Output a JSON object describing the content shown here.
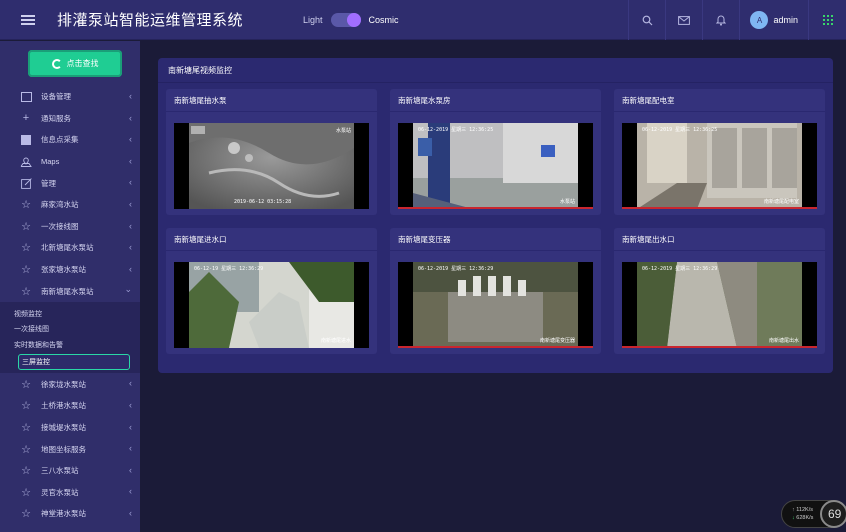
{
  "header": {
    "title": "排灌泵站智能运维管理系统",
    "theme_light": "Light",
    "theme_dark": "Cosmic",
    "user_avatar": "A",
    "username": "admin"
  },
  "sidebar": {
    "search_button": "点击查找",
    "items": [
      {
        "label": "设备管理"
      },
      {
        "label": "通知服务"
      },
      {
        "label": "信息点采集"
      },
      {
        "label": "Maps"
      },
      {
        "label": "管理"
      },
      {
        "label": "麻家湾水站"
      },
      {
        "label": "一次接线图"
      },
      {
        "label": "北新塘尾水泵站"
      },
      {
        "label": "张家塘水泵站"
      },
      {
        "label": "南新塘尾水泵站"
      },
      {
        "label": "徐家垅水泵站"
      },
      {
        "label": "土桥港水泵站"
      },
      {
        "label": "接城堤水泵站"
      },
      {
        "label": "地图坐标服务"
      },
      {
        "label": "三八水泵站"
      },
      {
        "label": "灵官水泵站"
      },
      {
        "label": "神堂港水泵站"
      }
    ],
    "submenu": [
      {
        "label": "视频监控"
      },
      {
        "label": "一次接线图"
      },
      {
        "label": "实时数据和告警"
      },
      {
        "label": "三屏监控"
      }
    ]
  },
  "main": {
    "title": "南新塘尾视频监控",
    "videos": [
      {
        "title": "南新塘尾抽水泵",
        "timestamp": "",
        "camera": "水泵站",
        "bottom_ts": "2019-06-12 03:15:28"
      },
      {
        "title": "南新塘尾水泵房",
        "timestamp": "06-12-2019 星期三 12:36:25",
        "camera": "水泵站"
      },
      {
        "title": "南新塘尾配电室",
        "timestamp": "06-12-2019 星期三 12:36:25",
        "camera": "南新塘尾配电室"
      },
      {
        "title": "南新塘尾进水口",
        "timestamp": "06-12-19 星期三 12:36:29",
        "camera": "南新塘尾进水"
      },
      {
        "title": "南新塘尾变压器",
        "timestamp": "06-12-2019 星期三 12:36:29",
        "camera": "南新塘尾变压器"
      },
      {
        "title": "南新塘尾出水口",
        "timestamp": "06-12-2019 星期三 12:36:29",
        "camera": "南新塘尾出水"
      }
    ]
  },
  "overlay": {
    "up_rate": "112K/s",
    "down_rate": "628K/s",
    "percent": "69"
  }
}
